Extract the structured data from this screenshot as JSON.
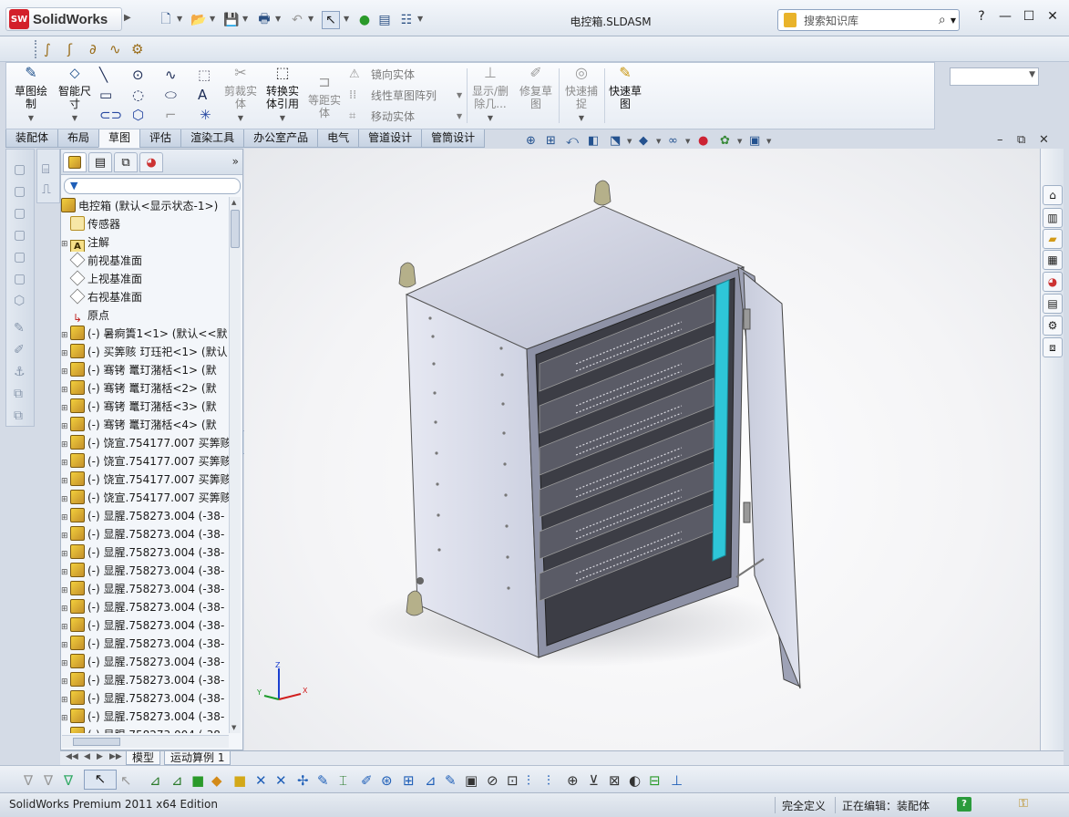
{
  "app": {
    "logo_badge": "SW",
    "logo_text": "SolidWorks",
    "document_title": "电控箱.SLDASM",
    "search_placeholder": "搜索知识库",
    "help": "?",
    "window_min": "—",
    "window_max": "☐",
    "window_close": "✕"
  },
  "commands": {
    "sketch": "草图绘制",
    "smart_dim": "智能尺寸",
    "trim": "剪裁实体",
    "convert": "转换实体引用",
    "offset": "等距实体",
    "mirror": "镜向实体",
    "linear_pattern": "线性草图阵列",
    "move": "移动实体",
    "display_delete": "显示/删除几...",
    "repair": "修复草图",
    "quick_snaps": "快速捕捉",
    "rapid_sketch": "快速草图"
  },
  "tabs": [
    "装配体",
    "布局",
    "草图",
    "评估",
    "渲染工具",
    "办公室产品",
    "电气",
    "管道设计",
    "管筒设计"
  ],
  "active_tab": "草图",
  "tree": {
    "root": "电控箱 (默认<显示状态-1>)",
    "items": [
      {
        "type": "sensor",
        "label": "传感器",
        "exp": false
      },
      {
        "type": "ann",
        "label": "注解",
        "exp": true
      },
      {
        "type": "plane",
        "label": "前视基准面",
        "exp": false
      },
      {
        "type": "plane",
        "label": "上视基准面",
        "exp": false
      },
      {
        "type": "plane",
        "label": "右视基准面",
        "exp": false
      },
      {
        "type": "origin",
        "label": "原点",
        "exp": false
      },
      {
        "type": "asm",
        "label": "(-) 暑痾簣1<1> (默认<<默",
        "exp": true
      },
      {
        "type": "asm",
        "label": "(-) 买筭赅 玎珏祀<1> (默认",
        "exp": true
      },
      {
        "type": "asm",
        "label": "(-) 骞铐    鼍玎潴栝<1> (默",
        "exp": true
      },
      {
        "type": "asm",
        "label": "(-) 骞铐    鼍玎潴栝<2> (默",
        "exp": true
      },
      {
        "type": "asm",
        "label": "(-) 骞铐    鼍玎潴栝<3> (默",
        "exp": true
      },
      {
        "type": "asm",
        "label": "(-) 骞铐    鼍玎潴栝<4> (默",
        "exp": true
      },
      {
        "type": "asm",
        "label": "(-) 饶宣.754177.007 买筭赅",
        "exp": true
      },
      {
        "type": "asm",
        "label": "(-) 饶宣.754177.007 买筭赅",
        "exp": true
      },
      {
        "type": "asm",
        "label": "(-) 饶宣.754177.007 买筭赅",
        "exp": true
      },
      {
        "type": "asm",
        "label": "(-) 饶宣.754177.007 买筭赅",
        "exp": true
      },
      {
        "type": "asm",
        "label": "(-) 显腥.758273.004 (-38-",
        "exp": true
      },
      {
        "type": "asm",
        "label": "(-) 显腥.758273.004 (-38-",
        "exp": true
      },
      {
        "type": "asm",
        "label": "(-) 显腥.758273.004 (-38-",
        "exp": true
      },
      {
        "type": "asm",
        "label": "(-) 显腥.758273.004 (-38-",
        "exp": true
      },
      {
        "type": "asm",
        "label": "(-) 显腥.758273.004 (-38-",
        "exp": true
      },
      {
        "type": "asm",
        "label": "(-) 显腥.758273.004 (-38-",
        "exp": true
      },
      {
        "type": "asm",
        "label": "(-) 显腥.758273.004 (-38-",
        "exp": true
      },
      {
        "type": "asm",
        "label": "(-) 显腥.758273.004 (-38-",
        "exp": true
      },
      {
        "type": "asm",
        "label": "(-) 显腥.758273.004 (-38-",
        "exp": true
      },
      {
        "type": "asm",
        "label": "(-) 显腥.758273.004 (-38-",
        "exp": true
      },
      {
        "type": "asm",
        "label": "(-) 显腥.758273.004 (-38-",
        "exp": true
      },
      {
        "type": "asm",
        "label": "(-) 显腥.758273.004 (-38-",
        "exp": true
      },
      {
        "type": "asm",
        "label": "(-) 显腥.758273.004 (-38-",
        "exp": true
      }
    ]
  },
  "model_tabs": [
    "模型",
    "运动算例 1"
  ],
  "triad": {
    "x": "X",
    "y": "Y",
    "z": "Z"
  },
  "status": {
    "edition": "SolidWorks Premium 2011 x64 Edition",
    "state": "完全定义",
    "editing": "正在编辑：装配体",
    "help_badge": "?"
  },
  "colors": {
    "accent": "#d3202a",
    "cabinet": "#c9cde0",
    "highlight": "#2ec6d8"
  }
}
